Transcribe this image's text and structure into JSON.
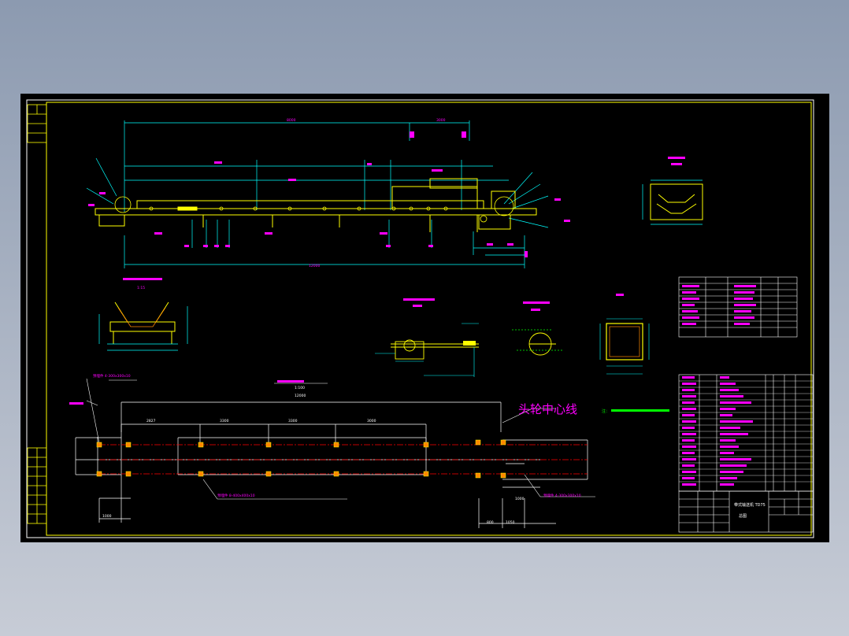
{
  "drawing": {
    "head_centerline_label": "头轮中心线",
    "overall_length": "12000",
    "top_dim_a": "8000",
    "top_dim_b": "3000",
    "plan_dims": [
      "2827",
      "3300",
      "3300",
      "3000"
    ],
    "plan_dim_bottom_left": "1000",
    "plan_dim_bottom_right_a": "1050",
    "plan_dim_bottom_right_b": "1000",
    "plan_dim_bottom_right_c": "800",
    "plan_scale": "1:100",
    "plan_len": "12000",
    "foundation_left_label": "预埋件 4-300x300x10",
    "foundation_mid_label": "预埋件 8-400x400x10",
    "foundation_right_label": "预埋件 4-300x300x10",
    "section_scale": "1:15",
    "note_label": "注：",
    "title_block_name": "带式输送机 TD75",
    "title_block_sub": "总图"
  },
  "colors": {
    "sheet": "#000000",
    "frame": "#ffff00",
    "yellow": "#ffff00",
    "cyan": "#00ffff",
    "magenta": "#ff00ff",
    "red": "#ff0000",
    "green": "#00ff00",
    "white": "#ffffff"
  }
}
